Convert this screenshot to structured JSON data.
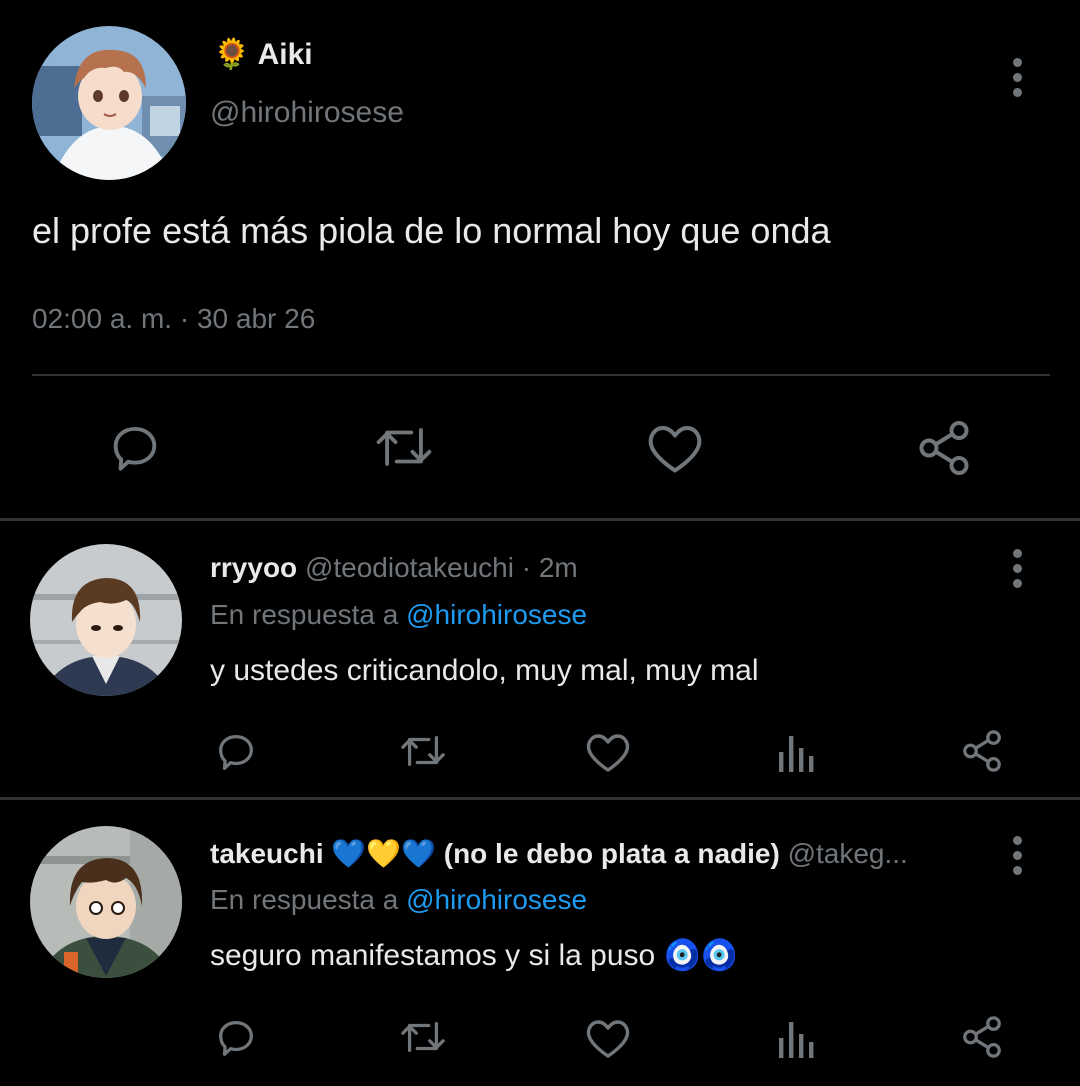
{
  "main_tweet": {
    "author": {
      "emoji": "🌻",
      "name": "Aiki",
      "handle": "@hirohirosese"
    },
    "text": "el profe está más piola de lo normal hoy que onda",
    "time": "02:00 a. m.",
    "separator": "·",
    "date": "30 abr 26",
    "actions": [
      "reply-icon",
      "retweet-icon",
      "like-icon",
      "share-icon"
    ]
  },
  "replies": [
    {
      "name": "rryyoo",
      "handle": "@teodiotakeuchi",
      "separator": "·",
      "time": "2m",
      "reply_prefix": "En respuesta a",
      "reply_to": "@hirohirosese",
      "text": "y ustedes criticandolo, muy mal, muy mal",
      "actions": [
        "reply-icon",
        "retweet-icon",
        "like-icon",
        "stats-icon",
        "share-icon"
      ]
    },
    {
      "name": "takeuchi 💙💛💙  (no le debo plata a nadie)",
      "handle": "@takeg...",
      "reply_prefix": "En respuesta a",
      "reply_to": "@hirohirosese",
      "text": "seguro manifestamos y si la puso 🧿🧿",
      "actions": [
        "reply-icon",
        "retweet-icon",
        "like-icon",
        "stats-icon",
        "share-icon"
      ]
    }
  ],
  "colors": {
    "background": "#000000",
    "text": "#e7e9ea",
    "muted": "#71767b",
    "link": "#1d9bf0",
    "divider": "#2f3336"
  }
}
